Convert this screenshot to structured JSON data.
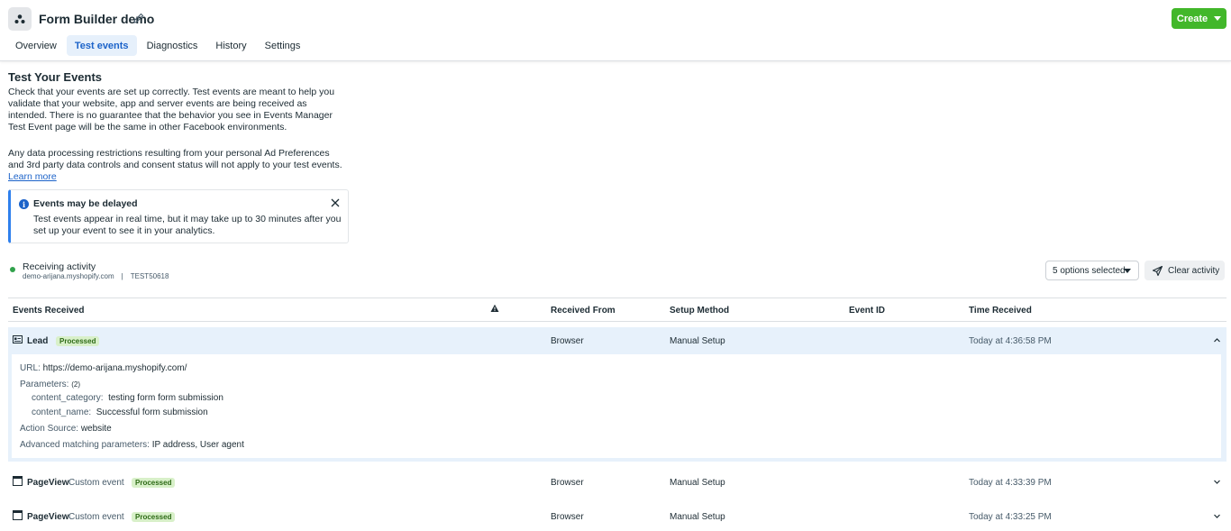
{
  "header": {
    "title": "Form Builder demo",
    "tabs": [
      {
        "label": "Overview"
      },
      {
        "label": "Test events"
      },
      {
        "label": "Diagnostics"
      },
      {
        "label": "History"
      },
      {
        "label": "Settings"
      }
    ],
    "create_label": "Create"
  },
  "intro": {
    "title": "Test Your Events",
    "p1": "Check that your events are set up correctly. Test events are meant to help you validate that your website, app and server events are being received as intended. There is no guarantee that the behavior you see in Events Manager Test Event page will be the same in other Facebook environments.",
    "p2": "Any data processing restrictions resulting from your personal Ad Preferences and 3rd party data controls and consent status will not apply to your test events.",
    "learn_more": "Learn more"
  },
  "notice": {
    "title": "Events may be delayed",
    "body": "Test events appear in real time, but it may take up to 30 minutes after you set up your event to see it in your analytics."
  },
  "activity": {
    "status": "Receiving activity",
    "domain": "demo-arijana.myshopify.com",
    "separator": "|",
    "code": "TEST50618",
    "options_label": "5 options selected",
    "clear_label": "Clear activity"
  },
  "table": {
    "headers": {
      "events": "Events Received",
      "from": "Received From",
      "method": "Setup Method",
      "id": "Event ID",
      "time": "Time Received"
    },
    "rows": [
      {
        "name": "Lead",
        "custom": "",
        "badge": "Processed",
        "from": "Browser",
        "method": "Manual Setup",
        "id": "",
        "time": "Today at 4:36:58 PM"
      },
      {
        "name": "PageView",
        "custom": "Custom event",
        "badge": "Processed",
        "from": "Browser",
        "method": "Manual Setup",
        "id": "",
        "time": "Today at 4:33:39 PM"
      },
      {
        "name": "PageView",
        "custom": "Custom event",
        "badge": "Processed",
        "from": "Browser",
        "method": "Manual Setup",
        "id": "",
        "time": "Today at 4:33:25 PM"
      }
    ],
    "detail": {
      "url_label": "URL:",
      "url_value": "https://demo-arijana.myshopify.com/",
      "params_label": "Parameters:",
      "params_count": "(2)",
      "param1_key": "content_category:",
      "param1_value": "testing form form submission",
      "param2_key": "content_name:",
      "param2_value": "Successful form submission",
      "action_label": "Action Source:",
      "action_value": "website",
      "adv_label": "Advanced matching parameters:",
      "adv_value": "IP address, User agent"
    }
  },
  "colors": {
    "accent": "#1c63c9",
    "create": "#42b72a",
    "status_dot": "#31a24c",
    "expanded_row": "#e7f1fb"
  }
}
